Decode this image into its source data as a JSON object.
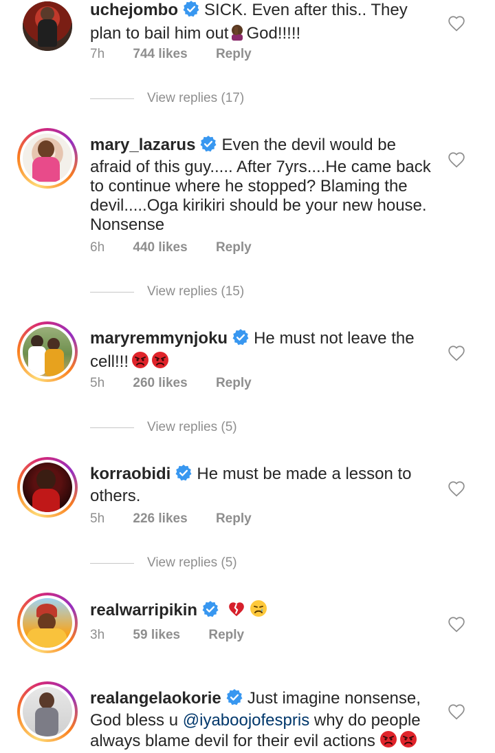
{
  "comments": [
    {
      "username": "uchejombo",
      "text_before": "SICK. Even after this.. They plan to bail him out",
      "text_after": "God!!!!!",
      "time": "7h",
      "likes": "744 likes",
      "reply": "Reply",
      "view_replies": "View replies (17)"
    },
    {
      "username": "mary_lazarus",
      "text": "Even the devil would be afraid of this guy..... After 7yrs....He came back to continue where he stopped? Blaming the devil.....Oga kirikiri should be your new house. Nonsense",
      "time": "6h",
      "likes": "440 likes",
      "reply": "Reply",
      "view_replies": "View replies (15)"
    },
    {
      "username": "maryremmynjoku",
      "text": "He must not leave the cell!!!",
      "time": "5h",
      "likes": "260 likes",
      "reply": "Reply",
      "view_replies": "View replies (5)"
    },
    {
      "username": "korraobidi",
      "text": "He must be made a lesson to others.",
      "time": "5h",
      "likes": "226 likes",
      "reply": "Reply",
      "view_replies": "View replies (5)"
    },
    {
      "username": "realwarripikin",
      "time": "3h",
      "likes": "59 likes",
      "reply": "Reply"
    },
    {
      "username": "realangelaokorie",
      "text_before": "Just imagine nonsense, God bless u",
      "mention": "@iyaboojofespris",
      "text_after": "why do people always blame devil for their evil actions"
    }
  ],
  "colors": {
    "verified": "#3897f0",
    "meta_grey": "#8e8e8e",
    "mention": "#00376b",
    "angry_emoji": "#e0242b"
  }
}
